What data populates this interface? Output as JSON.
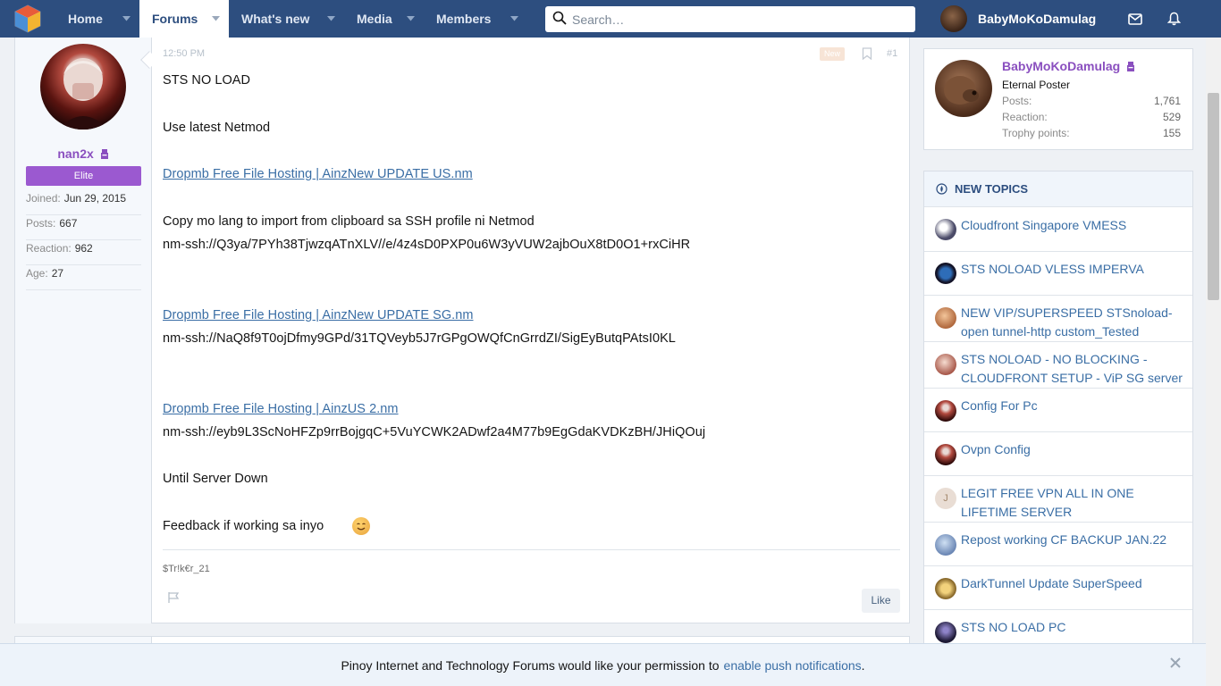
{
  "nav": {
    "logo_icon": "site-logo-icon",
    "tabs": [
      {
        "label": "Home",
        "active": false
      },
      {
        "label": "Forums",
        "active": true
      },
      {
        "label": "What's new",
        "active": false
      },
      {
        "label": "Media",
        "active": false
      },
      {
        "label": "Members",
        "active": false
      }
    ],
    "search_placeholder": "Search…",
    "username": "BabyMoKoDamulag"
  },
  "post": {
    "author": {
      "name": "nan2x",
      "title": "Elite",
      "stats": [
        {
          "label": "Joined:",
          "value": "Jun 29, 2015"
        },
        {
          "label": "Posts:",
          "value": "667"
        },
        {
          "label": "Reaction:",
          "value": "962"
        },
        {
          "label": "Age:",
          "value": "27"
        }
      ]
    },
    "time": "12:50 PM",
    "badge": "New",
    "number": "#1",
    "lines": [
      "STS NO LOAD",
      "Use latest Netmod",
      "Dropmb Free File Hosting | AinzNew UPDATE US.nm",
      "Copy mo lang to import from clipboard sa SSH profile ni Netmod",
      "nm-ssh://Q3ya/7PYh38TjwzqATnXLV//e/4z4sD0PXP0u6W3yVUW2ajbOuX8tD0O1+rxCiHR",
      "Dropmb Free File Hosting | AinzNew UPDATE SG.nm",
      "nm-ssh://NaQ8f9T0ojDfmy9GPd/31TQVeyb5J7rGPgOWQfCnGrrdZI/SigEyButqPAtsI0KL",
      "Dropmb Free File Hosting | AinzUS 2.nm",
      "nm-ssh://eyb9L3ScNoHFZp9rrBojgqC+5VuYCWK2ADwf2a4M77b9EgGdaKVDKzBH/JHiQOuj",
      "Until Server Down",
      "Feedback if working sa inyo"
    ],
    "signature": "$Tr!k€r_21",
    "like_label": "Like"
  },
  "sidebar": {
    "user": {
      "name": "BabyMoKoDamulag",
      "title": "Eternal Poster",
      "stats": [
        {
          "label": "Posts:",
          "value": "1,761"
        },
        {
          "label": "Reaction:",
          "value": "529"
        },
        {
          "label": "Trophy points:",
          "value": "155"
        }
      ]
    },
    "topics_heading": "NEW TOPICS",
    "topics": [
      "Cloudfront Singapore VMESS",
      "STS NOLOAD VLESS IMPERVA",
      "NEW VIP/SUPERSPEED STSnoload-open tunnel-http custom_Tested",
      "STS NOLOAD - NO BLOCKING - CLOUDFRONT SETUP - ViP SG server",
      "Config For Pc",
      "Ovpn Config",
      "LEGIT FREE VPN ALL IN ONE LIFETIME SERVER",
      "Repost working CF BACKUP JAN.22",
      "DarkTunnel Update SuperSpeed",
      "STS NO LOAD PC"
    ],
    "topic_initial": "J"
  },
  "push": {
    "text": "Pinoy Internet and Technology Forums would like your permission to",
    "link": "enable push notifications",
    "end": "."
  },
  "colors": {
    "nav_bg": "#2d4e7f",
    "username_purple": "#8a4fbf",
    "link": "#3a6ea5",
    "badge_elite": "#9b59d0"
  }
}
